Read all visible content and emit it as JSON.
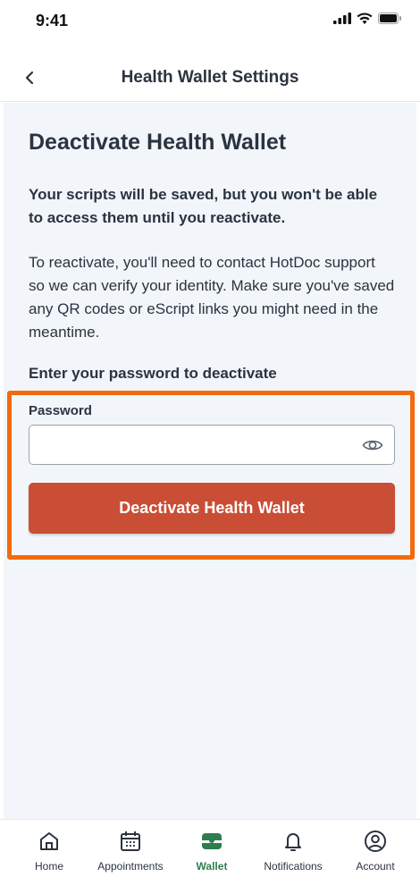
{
  "status_bar": {
    "time": "9:41"
  },
  "header": {
    "title": "Health Wallet Settings",
    "back_icon": "chevron-left-icon"
  },
  "main": {
    "title": "Deactivate Health Wallet",
    "lead": "Your scripts will be saved, but you won't be able to access them until you reactivate.",
    "body": "To reactivate, you'll need to contact HotDoc support so we can verify your identity. Make sure you've saved any QR codes or eScript links you might need in the meantime.",
    "prompt": "Enter your password to deactivate",
    "password_label": "Password",
    "password_value": "",
    "password_icon": "eye-icon",
    "button_label": "Deactivate Health Wallet"
  },
  "colors": {
    "button": "#c94e35",
    "highlight": "#f26a0f",
    "active_tab": "#2f7d4f",
    "content_bg": "#f2f6fa"
  },
  "tabs": [
    {
      "label": "Home",
      "icon": "home-icon",
      "active": false
    },
    {
      "label": "Appointments",
      "icon": "calendar-icon",
      "active": false
    },
    {
      "label": "Wallet",
      "icon": "wallet-icon",
      "active": true
    },
    {
      "label": "Notifications",
      "icon": "bell-icon",
      "active": false
    },
    {
      "label": "Account",
      "icon": "account-icon",
      "active": false
    }
  ]
}
